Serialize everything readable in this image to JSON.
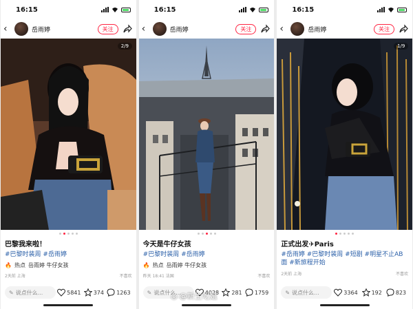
{
  "status_time": "16:15",
  "user_name": "岳雨婷",
  "follow_label": "关注",
  "comment_placeholder": "说点什么...",
  "accent_color": "#ff2442",
  "hot_label": "热点",
  "not_interested": "不喜欢",
  "watermark": "@新生吃姐",
  "screens": [
    {
      "counter": "2/9",
      "title": "巴黎我来啦！",
      "tags": "#巴黎时装周 #岳雨婷",
      "hot_text": "岳雨婷 牛仔女孩",
      "meta": "2天前 上海",
      "likes": "5841",
      "stars": "374",
      "comments": "1263"
    },
    {
      "counter": "",
      "title": "今天是牛仔女孩",
      "tags": "#巴黎时装周 #岳雨婷",
      "hot_text": "岳雨婷 牛仔女孩",
      "meta": "昨天 18:41 法国",
      "likes": "4028",
      "stars": "281",
      "comments": "1759"
    },
    {
      "counter": "1/9",
      "title": "正式出发✈Paris",
      "tags": "#岳雨婷 #巴黎时装周 #短剧 #明星不止AB面 #新旅程开始",
      "hot_text": "",
      "meta": "2天前 上海",
      "likes": "3364",
      "stars": "192",
      "comments": "823"
    }
  ]
}
